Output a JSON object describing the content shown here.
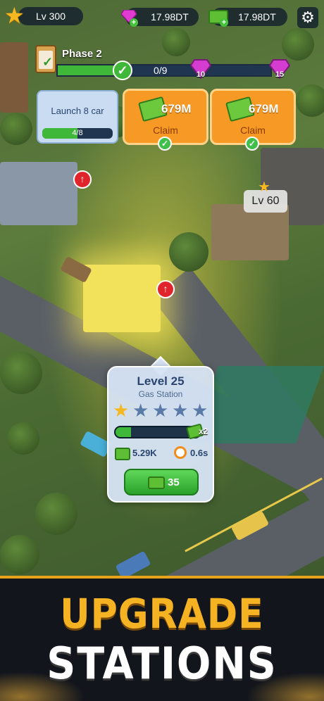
{
  "hud": {
    "level": "Lv 300",
    "gems": "17.98DT",
    "cash": "17.98DT",
    "settings_icon": "gear-icon"
  },
  "phase": {
    "label": "Phase 2",
    "progress": "0/9",
    "progress_fraction": 0.0,
    "milestones": [
      {
        "reward": "10",
        "icon": "gem-icon"
      },
      {
        "reward": "15",
        "icon": "gem-icon"
      }
    ]
  },
  "tasks": {
    "launch": {
      "title": "Launch 8 car",
      "progress": "4/8",
      "fraction": 0.5
    },
    "claims": [
      {
        "amount": "679M",
        "button": "Claim",
        "done": true
      },
      {
        "amount": "679M",
        "button": "Claim",
        "done": true
      }
    ]
  },
  "map": {
    "building_level": "Lv 60"
  },
  "station": {
    "level": "Level 25",
    "name": "Gas Station",
    "stars_filled": 1,
    "stars_total": 5,
    "progress_fraction": 0.18,
    "multiplier": "x2",
    "income": "5.29K",
    "time": "0.6s",
    "upgrade_cost": "35"
  },
  "banner": {
    "line1": "UPGRADE",
    "line2": "STATIONS"
  },
  "colors": {
    "accent_orange": "#f79a25",
    "progress_green": "#3fb83a",
    "banner_gold": "#f5b324"
  }
}
